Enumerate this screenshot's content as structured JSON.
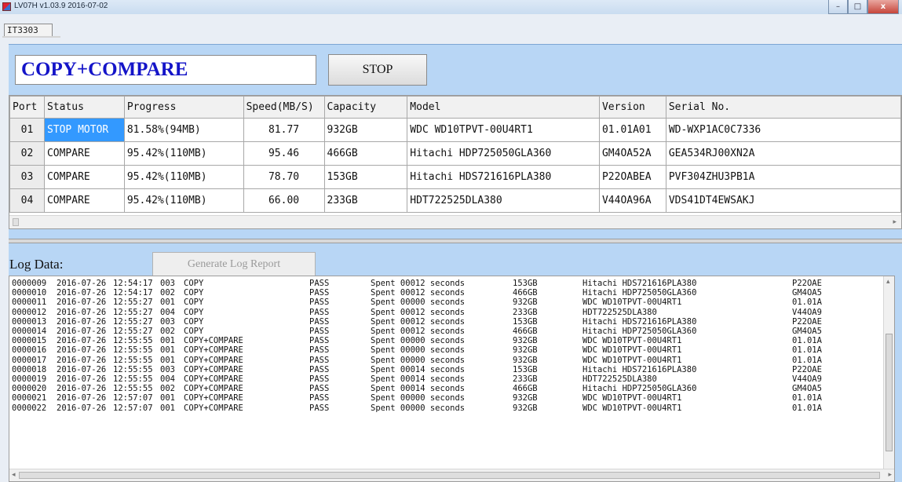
{
  "window": {
    "title": "LV07H v1.03.9 2016-07-02",
    "minimize_glyph": "–",
    "maximize_glyph": "□",
    "close_glyph": "x"
  },
  "device_tab": "IT3303",
  "mode_title": "COPY+COMPARE",
  "stop_button": "STOP",
  "grid": {
    "columns": [
      "Port",
      "Status",
      "Progress",
      "Speed(MB/S)",
      "Capacity",
      "Model",
      "Version",
      "Serial No."
    ],
    "rows": [
      {
        "port": "01",
        "status": "STOP MOTOR",
        "progress": "81.58%(94MB)",
        "speed": "81.77",
        "capacity": "932GB",
        "model": "WDC WD10TPVT-00U4RT1",
        "version": "01.01A01",
        "serial": "WD-WXP1AC0C7336",
        "selected": true
      },
      {
        "port": "02",
        "status": "COMPARE",
        "progress": "95.42%(110MB)",
        "speed": "95.46",
        "capacity": "466GB",
        "model": "Hitachi HDP725050GLA360",
        "version": "GM4OA52A",
        "serial": "GEA534RJ00XN2A",
        "selected": false
      },
      {
        "port": "03",
        "status": "COMPARE",
        "progress": "95.42%(110MB)",
        "speed": "78.70",
        "capacity": "153GB",
        "model": "Hitachi HDS721616PLA380",
        "version": "P22OABEA",
        "serial": "PVF304ZHU3PB1A",
        "selected": false
      },
      {
        "port": "04",
        "status": "COMPARE",
        "progress": "95.42%(110MB)",
        "speed": "66.00",
        "capacity": "233GB",
        "model": "HDT722525DLA380",
        "version": "V44OA96A",
        "serial": "VDS41DT4EWSAKJ",
        "selected": false
      }
    ]
  },
  "log": {
    "label": "Log Data:",
    "generate_button": "Generate Log Report",
    "entries": [
      {
        "id": "0000009",
        "date": "2016-07-26",
        "time": "12:54:17",
        "port": "003",
        "op": "COPY",
        "result": "PASS",
        "spent": "Spent 00012 seconds",
        "cap": "153GB",
        "model": "Hitachi HDS721616PLA380",
        "ver": "P22OAE"
      },
      {
        "id": "0000010",
        "date": "2016-07-26",
        "time": "12:54:17",
        "port": "002",
        "op": "COPY",
        "result": "PASS",
        "spent": "Spent 00012 seconds",
        "cap": "466GB",
        "model": "Hitachi HDP725050GLA360",
        "ver": "GM4OA5"
      },
      {
        "id": "0000011",
        "date": "2016-07-26",
        "time": "12:55:27",
        "port": "001",
        "op": "COPY",
        "result": "PASS",
        "spent": "Spent 00000 seconds",
        "cap": "932GB",
        "model": "WDC WD10TPVT-00U4RT1",
        "ver": "01.01A"
      },
      {
        "id": "0000012",
        "date": "2016-07-26",
        "time": "12:55:27",
        "port": "004",
        "op": "COPY",
        "result": "PASS",
        "spent": "Spent 00012 seconds",
        "cap": "233GB",
        "model": "HDT722525DLA380",
        "ver": "V44OA9"
      },
      {
        "id": "0000013",
        "date": "2016-07-26",
        "time": "12:55:27",
        "port": "003",
        "op": "COPY",
        "result": "PASS",
        "spent": "Spent 00012 seconds",
        "cap": "153GB",
        "model": "Hitachi HDS721616PLA380",
        "ver": "P22OAE"
      },
      {
        "id": "0000014",
        "date": "2016-07-26",
        "time": "12:55:27",
        "port": "002",
        "op": "COPY",
        "result": "PASS",
        "spent": "Spent 00012 seconds",
        "cap": "466GB",
        "model": "Hitachi HDP725050GLA360",
        "ver": "GM4OA5"
      },
      {
        "id": "0000015",
        "date": "2016-07-26",
        "time": "12:55:55",
        "port": "001",
        "op": "COPY+COMPARE",
        "result": "PASS",
        "spent": "Spent 00000 seconds",
        "cap": "932GB",
        "model": "WDC WD10TPVT-00U4RT1",
        "ver": "01.01A"
      },
      {
        "id": "0000016",
        "date": "2016-07-26",
        "time": "12:55:55",
        "port": "001",
        "op": "COPY+COMPARE",
        "result": "PASS",
        "spent": "Spent 00000 seconds",
        "cap": "932GB",
        "model": "WDC WD10TPVT-00U4RT1",
        "ver": "01.01A"
      },
      {
        "id": "0000017",
        "date": "2016-07-26",
        "time": "12:55:55",
        "port": "001",
        "op": "COPY+COMPARE",
        "result": "PASS",
        "spent": "Spent 00000 seconds",
        "cap": "932GB",
        "model": "WDC WD10TPVT-00U4RT1",
        "ver": "01.01A"
      },
      {
        "id": "0000018",
        "date": "2016-07-26",
        "time": "12:55:55",
        "port": "003",
        "op": "COPY+COMPARE",
        "result": "PASS",
        "spent": "Spent 00014 seconds",
        "cap": "153GB",
        "model": "Hitachi HDS721616PLA380",
        "ver": "P22OAE"
      },
      {
        "id": "0000019",
        "date": "2016-07-26",
        "time": "12:55:55",
        "port": "004",
        "op": "COPY+COMPARE",
        "result": "PASS",
        "spent": "Spent 00014 seconds",
        "cap": "233GB",
        "model": "HDT722525DLA380",
        "ver": "V44OA9"
      },
      {
        "id": "0000020",
        "date": "2016-07-26",
        "time": "12:55:55",
        "port": "002",
        "op": "COPY+COMPARE",
        "result": "PASS",
        "spent": "Spent 00014 seconds",
        "cap": "466GB",
        "model": "Hitachi HDP725050GLA360",
        "ver": "GM4OA5"
      },
      {
        "id": "0000021",
        "date": "2016-07-26",
        "time": "12:57:07",
        "port": "001",
        "op": "COPY+COMPARE",
        "result": "PASS",
        "spent": "Spent 00000 seconds",
        "cap": "932GB",
        "model": "WDC WD10TPVT-00U4RT1",
        "ver": "01.01A"
      },
      {
        "id": "0000022",
        "date": "2016-07-26",
        "time": "12:57:07",
        "port": "001",
        "op": "COPY+COMPARE",
        "result": "PASS",
        "spent": "Spent 00000 seconds",
        "cap": "932GB",
        "model": "WDC WD10TPVT-00U4RT1",
        "ver": "01.01A"
      }
    ]
  },
  "colors": {
    "panel_bg": "#b8d6f5",
    "mode_text": "#1414c8",
    "selected_status_bg": "#3399ff"
  }
}
